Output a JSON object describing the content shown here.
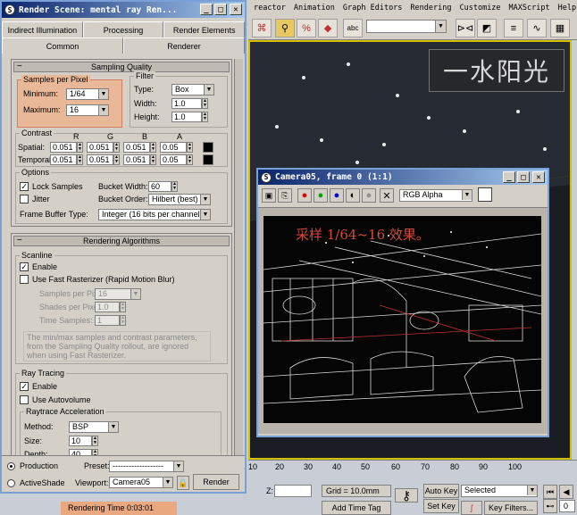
{
  "max": {
    "menu": [
      "reactor",
      "Animation",
      "Graph Editors",
      "Rendering",
      "Customize",
      "MAXScript",
      "Help"
    ],
    "watermark": "一水阳光",
    "timeline_ticks": [
      "10",
      "20",
      "30",
      "40",
      "50",
      "60",
      "70",
      "80",
      "90",
      "100"
    ],
    "z_label": "Z:",
    "grid_label": "Grid = 10.0mm",
    "auto_key": "Auto Key",
    "set_key": "Set Key",
    "selected_value": "Selected",
    "key_filters": "Key Filters...",
    "add_time_tag": "Add Time Tag",
    "rendering_time": "Rendering Time  0:03:01",
    "frame_value": "0"
  },
  "render": {
    "title": "Render Scene: mental ray Ren...",
    "tabs_top": [
      "Indirect Illumination",
      "Processing",
      "Render Elements"
    ],
    "tabs_bottom": [
      "Common",
      "Renderer"
    ],
    "sampling": {
      "header": "Sampling Quality",
      "spp_label": "Samples per Pixel",
      "min_label": "Minimum:",
      "min_value": "1/64",
      "max_label": "Maximum:",
      "max_value": "16",
      "filter_label": "Filter",
      "type_label": "Type:",
      "type_value": "Box",
      "width_label": "Width:",
      "width_value": "1.0",
      "height_label": "Height:",
      "height_value": "1.0",
      "contrast_label": "Contrast",
      "cols": [
        "R",
        "G",
        "B",
        "A"
      ],
      "spatial_label": "Spatial:",
      "spatial": [
        "0.051",
        "0.051",
        "0.051",
        "0.05"
      ],
      "temporal_label": "Temporal:",
      "temporal": [
        "0.051",
        "0.051",
        "0.051",
        "0.05"
      ],
      "options_label": "Options",
      "lock_samples": "Lock Samples",
      "jitter": "Jitter",
      "bucket_width_label": "Bucket Width:",
      "bucket_width": "60",
      "bucket_order_label": "Bucket Order:",
      "bucket_order": "Hilbert (best)",
      "fb_label": "Frame Buffer Type:",
      "fb_value": "Integer (16 bits per channel)"
    },
    "algorithms": {
      "header": "Rendering Algorithms",
      "scanline_label": "Scanline",
      "enable": "Enable",
      "fast_rast": "Use Fast Rasterizer (Rapid Motion Blur)",
      "spp": "Samples per Pixel:",
      "spp_val": "16",
      "shades": "Shades per Pixel:",
      "shades_val": "1.0",
      "time_samples": "Time Samples:",
      "time_val": "1",
      "note": "The min/max samples and contrast parameters, from the Sampling Quality rollout, are ignored when using Fast Rasterizer.",
      "rt_label": "Ray Tracing",
      "rt_enable": "Enable",
      "autovolume": "Use Autovolume",
      "accel_label": "Raytrace Acceleration",
      "method_label": "Method:",
      "method_value": "BSP",
      "size_label": "Size:",
      "size_value": "10",
      "depth_label": "Depth:",
      "depth_value": "40"
    },
    "footer": {
      "production": "Production",
      "activeshade": "ActiveShade",
      "preset_label": "Preset:",
      "preset_value": "-------------------",
      "viewport_label": "Viewport:",
      "viewport_value": "Camera05",
      "render_button": "Render"
    }
  },
  "camera": {
    "title": "Camera05, frame 0 (1:1)",
    "channel": "RGB Alpha",
    "overlay": "采样 1/64~16 效果。"
  }
}
